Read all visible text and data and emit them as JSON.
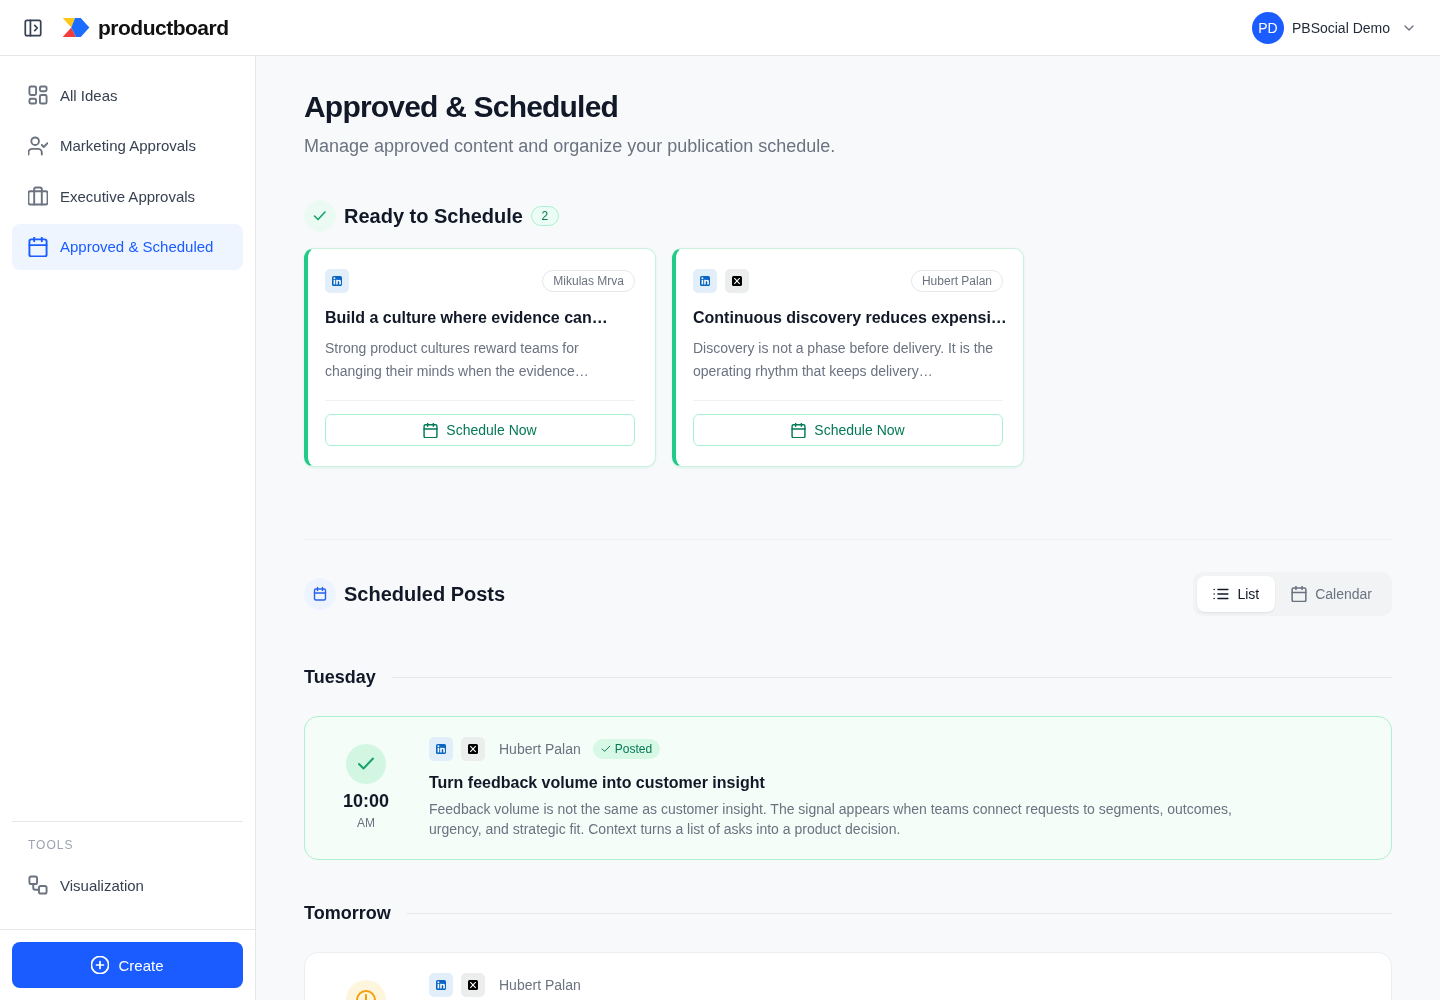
{
  "header": {
    "logo": "productboard",
    "user": {
      "initials": "PD",
      "name": "PBSocial Demo"
    }
  },
  "sidebar": {
    "items": [
      {
        "label": "All Ideas",
        "selected": false
      },
      {
        "label": "Marketing Approvals",
        "selected": false
      },
      {
        "label": "Executive Approvals",
        "selected": false
      },
      {
        "label": "Approved & Scheduled",
        "selected": true
      }
    ],
    "tools_heading": "TOOLS",
    "tools": [
      {
        "label": "Visualization",
        "selected": false
      }
    ],
    "create_button": "Create"
  },
  "page": {
    "title": "Approved & Scheduled",
    "subtitle": "Manage approved content and organize your publication schedule."
  },
  "ready_to_schedule": {
    "title": "Ready to Schedule",
    "count": "2",
    "cards": [
      {
        "platforms": [
          {
            "kind": "linkedin"
          }
        ],
        "author": "Mikulas Mrva",
        "title": "Build a culture where evidence can…",
        "excerpt": "Strong product cultures reward teams for changing their minds when the evidence…",
        "button": "Schedule Now"
      },
      {
        "platforms": [
          {
            "kind": "linkedin"
          },
          {
            "kind": "x"
          }
        ],
        "author": "Hubert Palan",
        "title": "Continuous discovery reduces expensi…",
        "excerpt": "Discovery is not a phase before delivery. It is the operating rhythm that keeps delivery…",
        "button": "Schedule Now"
      }
    ]
  },
  "scheduled_posts": {
    "title": "Scheduled Posts",
    "views": [
      {
        "label": "List",
        "selected": true
      },
      {
        "label": "Calendar",
        "selected": false
      }
    ],
    "days": [
      {
        "label": "Tuesday",
        "posts": [
          {
            "posted": true,
            "time": "10:00",
            "period": "AM",
            "platforms": [
              {
                "kind": "linkedin"
              },
              {
                "kind": "x"
              }
            ],
            "author": "Hubert Palan",
            "status_label": "Posted",
            "title": "Turn feedback volume into customer insight",
            "description": "Feedback volume is not the same as customer insight. The signal appears when teams connect requests to segments, outcomes, urgency, and strategic fit. Context turns a list of asks into a product decision."
          }
        ]
      },
      {
        "label": "Tomorrow",
        "posts": [
          {
            "posted": false,
            "platforms": [
              {
                "kind": "linkedin"
              },
              {
                "kind": "x"
              }
            ],
            "author": "Hubert Palan"
          }
        ]
      }
    ]
  }
}
